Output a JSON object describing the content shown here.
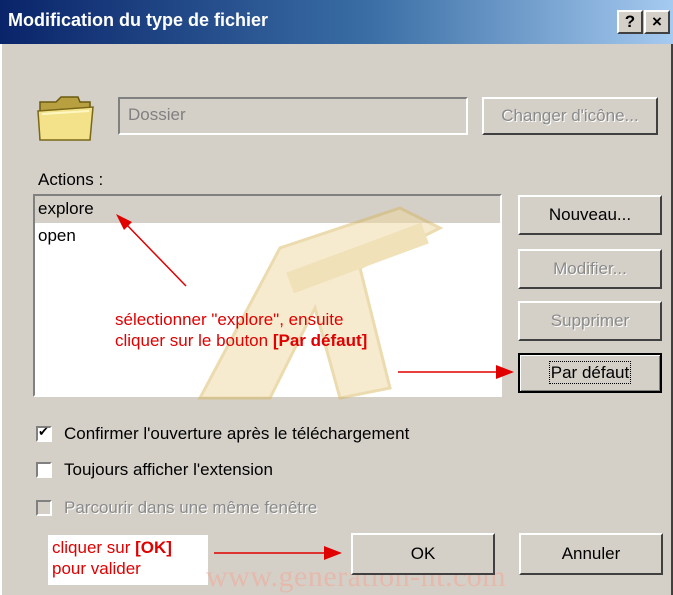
{
  "window": {
    "title": "Modification du type de fichier",
    "help_label": "?",
    "close_label": "×"
  },
  "file_type": {
    "description_value": "Dossier",
    "change_icon_label": "Changer d'icône..."
  },
  "actions": {
    "label": "Actions :",
    "items": [
      {
        "label": "explore",
        "selected": true
      },
      {
        "label": "open",
        "selected": false
      }
    ],
    "buttons": {
      "new_label": "Nouveau...",
      "edit_label": "Modifier...",
      "delete_label": "Supprimer",
      "default_label": "Par défaut"
    }
  },
  "options": {
    "confirm_open": {
      "label": "Confirmer l'ouverture après le téléchargement",
      "checked": true
    },
    "always_show_ext": {
      "label": "Toujours afficher l'extension",
      "checked": false
    },
    "browse_same_window": {
      "label": "Parcourir dans une même fenêtre",
      "checked": false,
      "disabled": true
    }
  },
  "footer": {
    "ok_label": "OK",
    "cancel_label": "Annuler"
  },
  "annotations": {
    "list_line1": "sélectionner \"explore\", ensuite",
    "list_line2_prefix": "cliquer sur le bouton ",
    "list_line2_bold": "[Par défaut]",
    "ok_line1_prefix": "cliquer sur ",
    "ok_line1_bold": "[OK]",
    "ok_line2": "pour valider",
    "color": "#e00000"
  },
  "watermarks": {
    "site": "www.generation-nt.com",
    "logo_text": "GENERATION NT"
  }
}
